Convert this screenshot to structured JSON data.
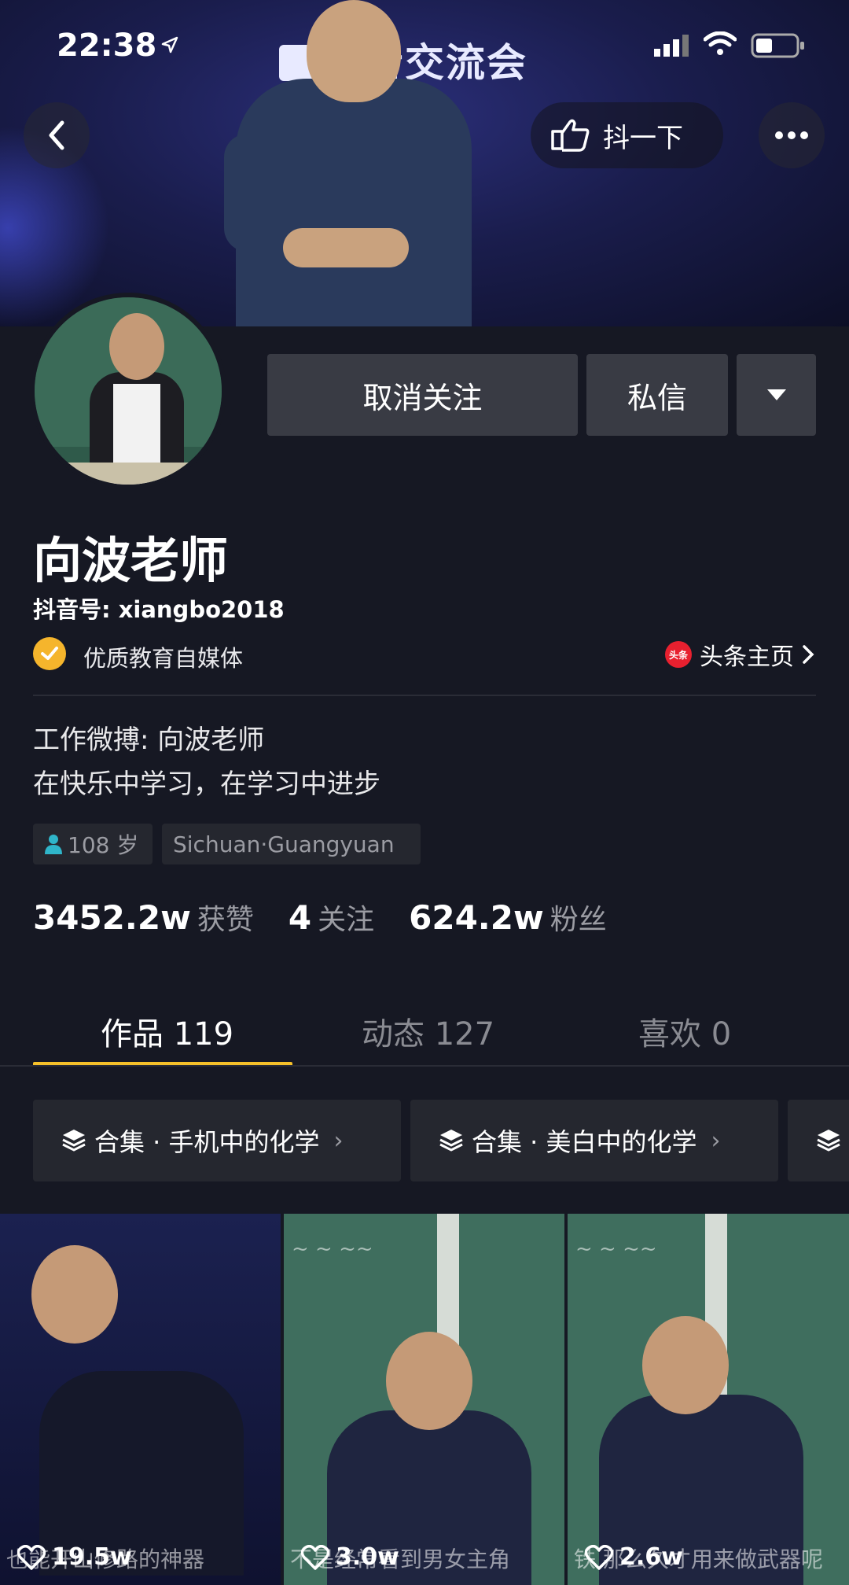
{
  "status": {
    "time": "22:38"
  },
  "banner": {
    "sign_text": "作者交流会"
  },
  "header": {
    "shake_label": "抖一下"
  },
  "actions": {
    "unfollow_label": "取消关注",
    "message_label": "私信"
  },
  "profile": {
    "nickname": "向波老师",
    "douyin_id": "抖音号: xiangbo2018",
    "verification": "优质教育自媒体",
    "toutiao_icon_text": "头条",
    "toutiao_label": "头条主页",
    "bio_line1": "工作微搏: 向波老师",
    "bio_line2": "在快乐中学习，在学习中进步",
    "age_tag": "108 岁",
    "location_tag": "Sichuan·Guangyuan"
  },
  "stats": [
    {
      "value": "3452.2w",
      "label": "获赞"
    },
    {
      "value": "4",
      "label": "关注"
    },
    {
      "value": "624.2w",
      "label": "粉丝"
    }
  ],
  "tabs": [
    {
      "label": "作品 119",
      "active": true
    },
    {
      "label": "动态 127",
      "active": false
    },
    {
      "label": "喜欢 0",
      "active": false
    }
  ],
  "collections": [
    {
      "label": "合集 · 手机中的化学"
    },
    {
      "label": "合集 · 美白中的化学"
    }
  ],
  "videos": [
    {
      "likes": "19.5w",
      "caption": "也能开山修路的神器"
    },
    {
      "likes": "3.0w",
      "caption": "不是经常看到男女主角"
    },
    {
      "likes": "2.6w",
      "caption": "铁 那么久才用来做武器呢"
    }
  ],
  "colors": {
    "background": "#161823",
    "accent_underline": "#f5c02a",
    "verify_badge": "#f5b52c",
    "toutiao_red": "#e8202f"
  }
}
